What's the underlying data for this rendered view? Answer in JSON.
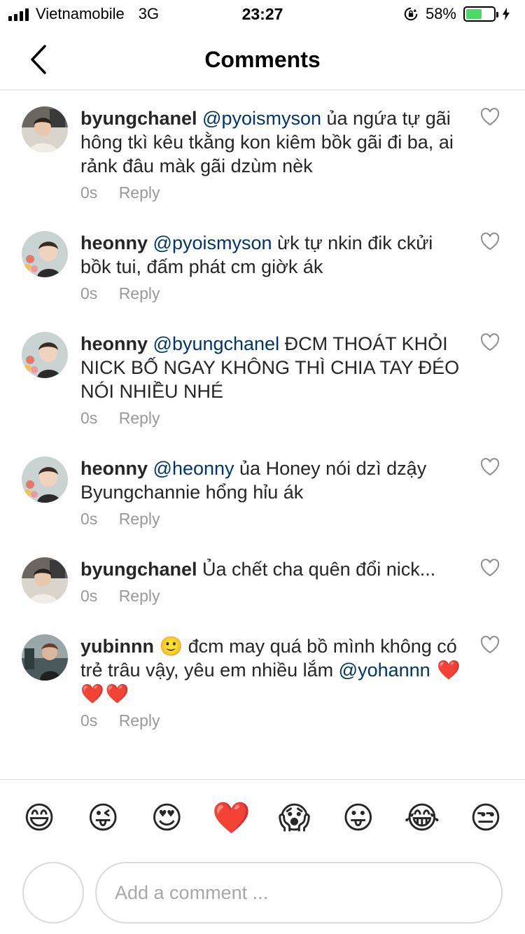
{
  "status_bar": {
    "carrier": "Vietnamobile",
    "network": "3G",
    "time": "23:27",
    "battery_percent": "58%",
    "battery_level": 0.58,
    "battery_color": "#4cd964"
  },
  "nav": {
    "back_icon": "chevron-left-icon",
    "title": "Comments"
  },
  "comments": [
    {
      "username": "byungchanel",
      "mention": "@pyoismyson",
      "text": " ủa ngứa tự gãi hông tkì kêu tkằng kon kiêm bồk gãi đi ba, ai rảnk đâu màk gãi dzùm nèk",
      "time": "0s",
      "reply_label": "Reply"
    },
    {
      "username": "heonny",
      "mention": "@pyoismyson",
      "text": " ừk tự nkin đik ckửi bồk tui, đấm phát cm giờk ák",
      "time": "0s",
      "reply_label": "Reply"
    },
    {
      "username": "heonny",
      "mention": "@byungchanel",
      "text": " ĐCM THOÁT KHỎI NICK BỐ NGAY KHÔNG THÌ CHIA TAY ĐÉO NÓI NHIỀU NHÉ",
      "time": "0s",
      "reply_label": "Reply"
    },
    {
      "username": "heonny",
      "mention": "@heonny",
      "text": " ủa Honey nói dzì dzậy Byungchannie hổng hỉu ák",
      "time": "0s",
      "reply_label": "Reply"
    },
    {
      "username": "byungchanel",
      "mention": "",
      "text": " Ủa chết cha quên đổi nick...",
      "time": "0s",
      "reply_label": "Reply"
    },
    {
      "username": "yubinnn",
      "text_prefix": " 🙂 đcm may quá bồ mình không có trẻ trâu vậy, yêu em nhiều lắm ",
      "mention": "@yohannn",
      "hearts": " ❤️❤️❤️",
      "time": "0s",
      "reply_label": "Reply"
    }
  ],
  "quick_emojis": [
    "😄",
    "😜",
    "😍",
    "❤️",
    "😱",
    "😛",
    "😂",
    "😒"
  ],
  "composer": {
    "placeholder": "Add a comment ..."
  },
  "colors": {
    "mention": "#003569",
    "meta_gray": "#999999",
    "divider": "#dbdbdb"
  }
}
